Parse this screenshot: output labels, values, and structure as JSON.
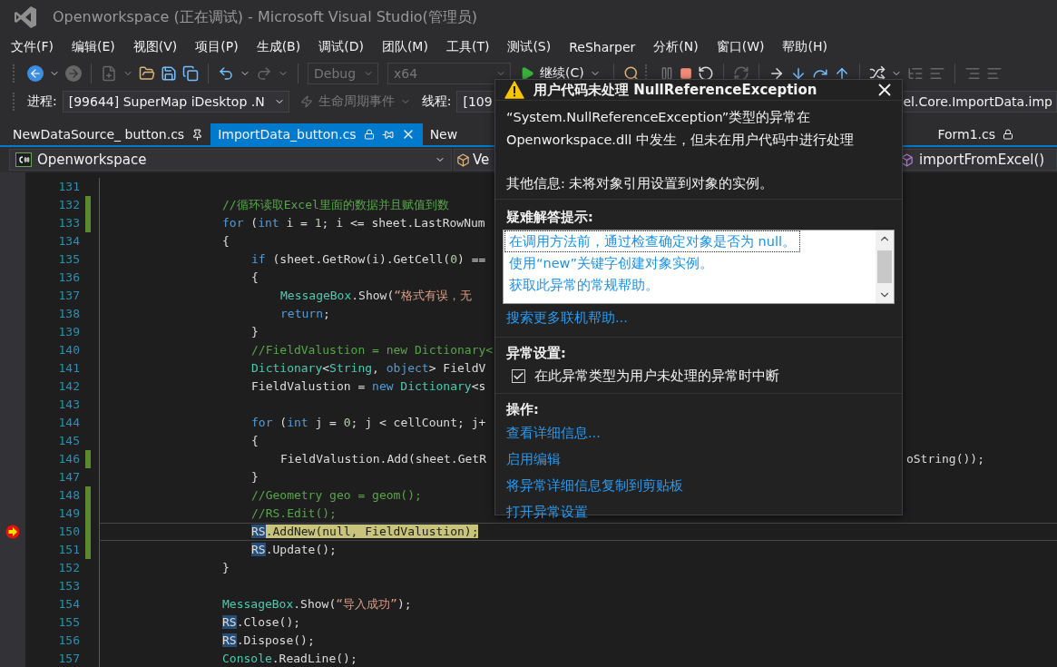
{
  "window": {
    "title": "Openworkspace (正在调试) - Microsoft Visual Studio(管理员)"
  },
  "menu": [
    "文件(F)",
    "编辑(E)",
    "视图(V)",
    "项目(P)",
    "生成(B)",
    "调试(D)",
    "团队(M)",
    "工具(T)",
    "测试(S)",
    "ReSharper",
    "分析(N)",
    "窗口(W)",
    "帮助(H)"
  ],
  "toolbar": {
    "configuration": "Debug",
    "platform": "x64",
    "continue": "继续(C)"
  },
  "debug_location": {
    "process_label": "进程:",
    "process": "[99644] SuperMap iDesktop .N",
    "lifecycle": "生命周期事件",
    "thread_label": "线程:",
    "thread": "[109",
    "stack_frame": "el.Core.ImportData.imp"
  },
  "tabs": [
    {
      "label": "NewDataSource_ button.cs",
      "selected": false,
      "pinned": true,
      "read_only": false
    },
    {
      "label": "ImportData_button.cs",
      "selected": true,
      "pinned": false,
      "read_only": true
    },
    {
      "label": "New",
      "selected": false,
      "pinned": false,
      "read_only": false
    }
  ],
  "right_tabs": [
    {
      "label": "Form1.cs",
      "selected": false,
      "pinned": false,
      "read_only": true
    }
  ],
  "nav": {
    "project": "Openworkspace",
    "type": "Ve",
    "member": "importFromExcel()"
  },
  "editor": {
    "lines": [
      {
        "number": "131",
        "changed": false,
        "current": false
      },
      {
        "number": "132",
        "changed": true,
        "current": false,
        "tokens": [
          {
            "kind": "comment",
            "text": "//循环读取Excel里面的数据并且赋值到数"
          }
        ]
      },
      {
        "number": "133",
        "changed": true,
        "current": false,
        "tokens": [
          {
            "kind": "keyword",
            "text": "for"
          },
          {
            "kind": "plain",
            "text": " ("
          },
          {
            "kind": "keyword",
            "text": "int"
          },
          {
            "kind": "plain",
            "text": " i = "
          },
          {
            "kind": "number",
            "text": "1"
          },
          {
            "kind": "plain",
            "text": "; i <= sheet.LastRowNum"
          }
        ]
      },
      {
        "number": "134",
        "changed": false,
        "current": false,
        "tokens": [
          {
            "kind": "plain",
            "text": "{"
          }
        ],
        "children": [
          {
            "number": "135",
            "changed": false,
            "current": false,
            "tokens": [
              {
                "kind": "keyword",
                "text": "if"
              },
              {
                "kind": "plain",
                "text": " (sheet.GetRow(i).GetCell("
              },
              {
                "kind": "number",
                "text": "0"
              },
              {
                "kind": "plain",
                "text": ") =="
              }
            ]
          },
          {
            "number": "136",
            "changed": false,
            "current": false,
            "tokens": [
              {
                "kind": "plain",
                "text": "{"
              }
            ],
            "children": [
              {
                "number": "137",
                "changed": false,
                "current": false,
                "tokens": [
                  {
                    "kind": "type",
                    "text": "MessageBox"
                  },
                  {
                    "kind": "plain",
                    "text": ".Show("
                  },
                  {
                    "kind": "string",
                    "text": "“格式有误，无"
                  }
                ]
              },
              {
                "number": "138",
                "changed": false,
                "current": false,
                "tokens": [
                  {
                    "kind": "keyword",
                    "text": "return"
                  },
                  {
                    "kind": "plain",
                    "text": ";"
                  }
                ]
              }
            ]
          },
          {
            "number": "139",
            "changed": false,
            "current": false,
            "tokens": [
              {
                "kind": "plain",
                "text": "}"
              }
            ]
          },
          {
            "number": "140",
            "changed": false,
            "current": false,
            "tokens": [
              {
                "kind": "comment",
                "text": "//FieldValustion = new Dictionary<"
              }
            ]
          },
          {
            "number": "141",
            "changed": false,
            "current": false,
            "tokens": [
              {
                "kind": "type",
                "text": "Dictionary"
              },
              {
                "kind": "plain",
                "text": "<"
              },
              {
                "kind": "type",
                "text": "String"
              },
              {
                "kind": "plain",
                "text": ", "
              },
              {
                "kind": "keyword",
                "text": "object"
              },
              {
                "kind": "plain",
                "text": "> FieldV"
              }
            ]
          },
          {
            "number": "142",
            "changed": false,
            "current": false,
            "tokens": [
              {
                "kind": "plain",
                "text": "FieldValustion = "
              },
              {
                "kind": "keyword",
                "text": "new"
              },
              {
                "kind": "type",
                "text": " Dictionary"
              },
              {
                "kind": "plain",
                "text": "<s"
              }
            ]
          },
          {
            "number": "143",
            "changed": false,
            "current": false
          },
          {
            "number": "144",
            "changed": false,
            "current": false,
            "tokens": [
              {
                "kind": "keyword",
                "text": "for"
              },
              {
                "kind": "plain",
                "text": " ("
              },
              {
                "kind": "keyword",
                "text": "int"
              },
              {
                "kind": "plain",
                "text": " j = "
              },
              {
                "kind": "number",
                "text": "0"
              },
              {
                "kind": "plain",
                "text": "; j < cellCount; j+"
              }
            ]
          },
          {
            "number": "145",
            "changed": false,
            "current": false,
            "tokens": [
              {
                "kind": "plain",
                "text": "{"
              }
            ],
            "children": [
              {
                "number": "146",
                "changed": true,
                "current": false,
                "tokens": [
                  {
                    "kind": "plain",
                    "text": "FieldValustion.Add(sheet.GetR"
                  }
                ],
                "tail": "oString());"
              }
            ]
          },
          {
            "number": "147",
            "changed": false,
            "current": false,
            "tokens": [
              {
                "kind": "plain",
                "text": "}"
              }
            ]
          },
          {
            "number": "148",
            "changed": true,
            "current": false,
            "tokens": [
              {
                "kind": "comment",
                "text": "//Geometry geo = geom();"
              }
            ]
          },
          {
            "number": "149",
            "changed": true,
            "current": false,
            "tokens": [
              {
                "kind": "comment",
                "text": "//RS.Edit();"
              }
            ]
          },
          {
            "number": "150",
            "changed": true,
            "current": true,
            "tokens": [
              {
                "kind": "ref",
                "text": "RS"
              },
              {
                "kind": "plain",
                "text": ".AddNew(null, FieldValustion);"
              }
            ]
          },
          {
            "number": "151",
            "changed": true,
            "current": false,
            "tokens": [
              {
                "kind": "ref",
                "text": "RS"
              },
              {
                "kind": "plain",
                "text": ".Update();"
              }
            ]
          }
        ]
      },
      {
        "number": "152",
        "changed": false,
        "current": false,
        "tokens": [
          {
            "kind": "plain",
            "text": "}"
          }
        ]
      },
      {
        "number": "153",
        "changed": false,
        "current": false
      },
      {
        "number": "154",
        "changed": false,
        "current": false,
        "tokens": [
          {
            "kind": "type",
            "text": "MessageBox"
          },
          {
            "kind": "plain",
            "text": ".Show("
          },
          {
            "kind": "string",
            "text": "“导入成功”"
          },
          {
            "kind": "plain",
            "text": ");"
          }
        ]
      },
      {
        "number": "155",
        "changed": false,
        "current": false,
        "tokens": [
          {
            "kind": "ref",
            "text": "RS"
          },
          {
            "kind": "plain",
            "text": ".Close();"
          }
        ]
      },
      {
        "number": "156",
        "changed": false,
        "current": false,
        "tokens": [
          {
            "kind": "ref",
            "text": "RS"
          },
          {
            "kind": "plain",
            "text": ".Dispose();"
          }
        ]
      },
      {
        "number": "157",
        "changed": false,
        "current": false,
        "tokens": [
          {
            "kind": "type",
            "text": "Console"
          },
          {
            "kind": "plain",
            "text": ".ReadLine();"
          }
        ]
      }
    ]
  },
  "exception": {
    "title": "用户代码未处理 NullReferenceException",
    "message": [
      "“System.NullReferenceException”类型的异常在",
      "Openworkspace.dll 中发生，但未在用户代码中进行处理"
    ],
    "details": "其他信息: 未将对象引用设置到对象的实例。",
    "tips_heading": "疑难解答提示:",
    "tips": [
      {
        "text": "在调用方法前，通过检查确定对象是否为 null。",
        "selected": true
      },
      {
        "text": "使用“new”关键字创建对象实例。",
        "selected": false
      },
      {
        "text": "获取此异常的常规帮助。",
        "selected": false
      }
    ],
    "more_help": "搜索更多联机帮助...",
    "settings_heading": "异常设置:",
    "break_option": {
      "label": "在此异常类型为用户未处理的异常时中断",
      "checked": true
    },
    "actions_heading": "操作:",
    "actions": [
      "查看详细信息...",
      "启用编辑",
      "将异常详细信息复制到剪贴板",
      "打开异常设置"
    ]
  }
}
